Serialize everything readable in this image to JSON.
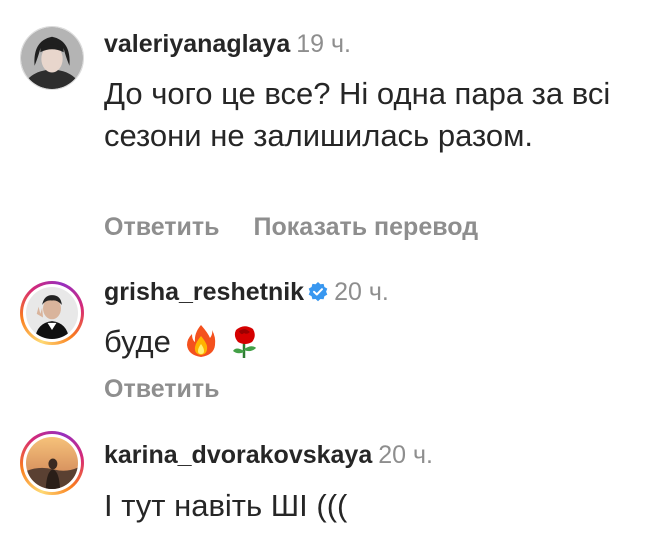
{
  "comments": [
    {
      "username": "valeriyanaglaya",
      "time": "19 ч.",
      "text": "До чого це все? Ні одна пара за всі сезони не залишилась разом.",
      "reply_label": "Ответить",
      "translate_label": "Показать перевод",
      "avatar_icon": "profile-photo",
      "has_story_ring": false,
      "verified": false
    },
    {
      "username": "grisha_reshetnik",
      "time": "20 ч.",
      "text": "буде",
      "emojis": [
        "fire-emoji",
        "rose-emoji"
      ],
      "reply_label": "Ответить",
      "avatar_icon": "profile-photo",
      "has_story_ring": true,
      "verified": true,
      "verified_color": "#3897f0"
    },
    {
      "username": "karina_dvorakovskaya",
      "time": "20 ч.",
      "text": "І тут навіть ШІ (((",
      "avatar_icon": "profile-photo",
      "has_story_ring": true,
      "verified": false
    }
  ],
  "colors": {
    "primary_text": "#262626",
    "secondary_text": "#8e8e8e",
    "verified_badge": "#3897f0"
  }
}
